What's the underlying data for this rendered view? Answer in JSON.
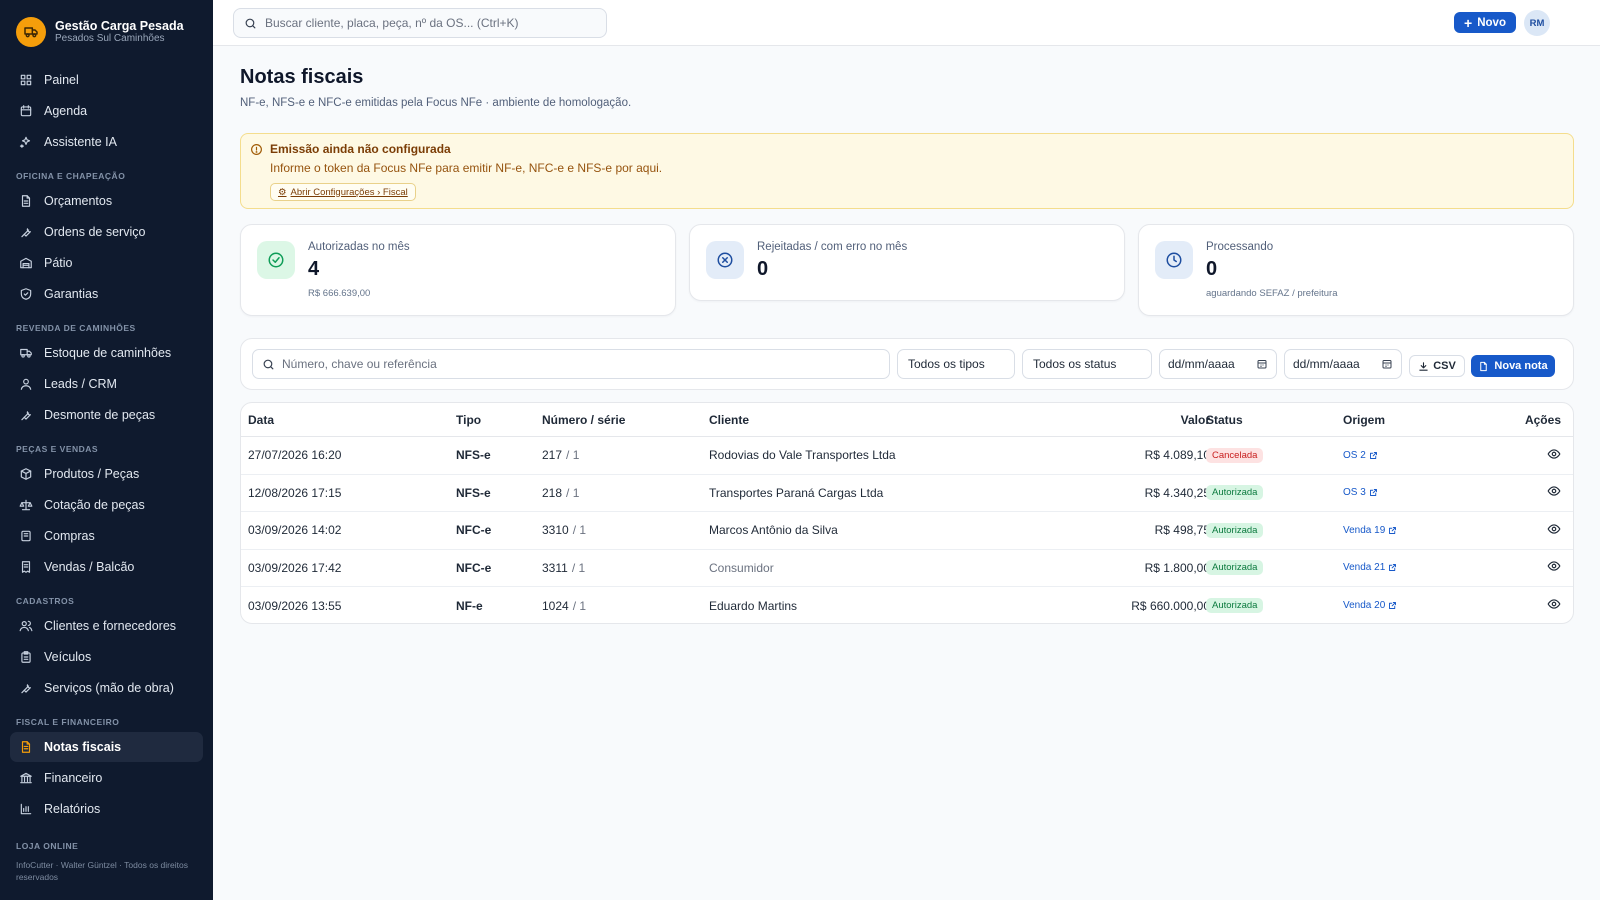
{
  "brand": {
    "title": "Gestão Carga Pesada",
    "subtitle": "Pesados Sul Caminhões"
  },
  "topbar": {
    "search_placeholder": "Buscar cliente, placa, peça, nº da OS...  (Ctrl+K)",
    "new_button": "Novo",
    "avatar_initials": "RM"
  },
  "sidebar": {
    "top_items": [
      {
        "label": "Painel",
        "icon": "dashboard-icon"
      },
      {
        "label": "Agenda",
        "icon": "calendar-icon"
      },
      {
        "label": "Assistente IA",
        "icon": "sparkles-icon"
      }
    ],
    "sections": [
      {
        "title": "OFICINA E CHAPEAÇÃO",
        "items": [
          {
            "label": "Orçamentos",
            "icon": "document-icon"
          },
          {
            "label": "Ordens de serviço",
            "icon": "wrench-icon"
          },
          {
            "label": "Pátio",
            "icon": "warehouse-icon"
          },
          {
            "label": "Garantias",
            "icon": "shield-icon"
          }
        ]
      },
      {
        "title": "REVENDA DE CAMINHÕES",
        "items": [
          {
            "label": "Estoque de caminhões",
            "icon": "truck-icon"
          },
          {
            "label": "Leads / CRM",
            "icon": "user-icon"
          },
          {
            "label": "Desmonte de peças",
            "icon": "wrench-icon"
          }
        ]
      },
      {
        "title": "PEÇAS E VENDAS",
        "items": [
          {
            "label": "Produtos / Peças",
            "icon": "box-icon"
          },
          {
            "label": "Cotação de peças",
            "icon": "scale-icon"
          },
          {
            "label": "Compras",
            "icon": "cart-icon"
          },
          {
            "label": "Vendas / Balcão",
            "icon": "receipt-icon"
          }
        ]
      },
      {
        "title": "CADASTROS",
        "items": [
          {
            "label": "Clientes e fornecedores",
            "icon": "users-icon"
          },
          {
            "label": "Veículos",
            "icon": "clipboard-icon"
          },
          {
            "label": "Serviços (mão de obra)",
            "icon": "wrench-icon"
          }
        ]
      },
      {
        "title": "FISCAL E FINANCEIRO",
        "items": [
          {
            "label": "Notas fiscais",
            "icon": "invoice-icon",
            "active": true
          },
          {
            "label": "Financeiro",
            "icon": "bank-icon"
          },
          {
            "label": "Relatórios",
            "icon": "bar-chart-icon"
          }
        ]
      }
    ],
    "footer_section": "LOJA ONLINE",
    "footer_text": "InfoCutter · Walter Güntzel · Todos os direitos reservados"
  },
  "page": {
    "title": "Notas fiscais",
    "subtitle": "NF-e, NFS-e e NFC-e emitidas pela Focus NFe · ambiente de homologação."
  },
  "alert": {
    "title": "Emissão ainda não configurada",
    "text": "Informe o token da Focus NFe para emitir NF-e, NFC-e e NFS-e por aqui.",
    "link": "Abrir Configurações › Fiscal"
  },
  "stats": [
    {
      "label": "Autorizadas no mês",
      "value": "4",
      "sub": "R$ 666.639,00",
      "icon": "check-circle-icon",
      "color": "#0f9d58",
      "bg": "#dcf7e6"
    },
    {
      "label": "Rejeitadas / com erro no mês",
      "value": "0",
      "sub": "",
      "icon": "x-circle-icon",
      "color": "#1e4ea0",
      "bg": "#e3ecf8"
    },
    {
      "label": "Processando",
      "value": "0",
      "sub": "aguardando SEFAZ / prefeitura",
      "icon": "clock-icon",
      "color": "#1e4ea0",
      "bg": "#e3ecf8"
    }
  ],
  "filters": {
    "search_placeholder": "Número, chave ou referência",
    "type_select": "Todos os tipos",
    "status_select": "Todos os status",
    "date_from": "dd/mm/aaaa",
    "date_to": "dd/mm/aaaa",
    "csv_label": "CSV",
    "new_invoice_label": "Nova nota"
  },
  "table": {
    "headers": {
      "data": "Data",
      "tipo": "Tipo",
      "numero": "Número / série",
      "cliente": "Cliente",
      "valor": "Valor",
      "status": "Status",
      "origem": "Origem",
      "acoes": "Ações"
    },
    "rows": [
      {
        "data": "27/07/2026 16:20",
        "tipo": "NFS-e",
        "numero": "217",
        "serie": "/ 1",
        "cliente": "Rodovias do Vale Transportes Ltda",
        "valor": "R$ 4.089,10",
        "status": "Cancelada",
        "origem": "OS 2"
      },
      {
        "data": "12/08/2026 17:15",
        "tipo": "NFS-e",
        "numero": "218",
        "serie": "/ 1",
        "cliente": "Transportes Paraná Cargas Ltda",
        "valor": "R$ 4.340,25",
        "status": "Autorizada",
        "origem": "OS 3"
      },
      {
        "data": "03/09/2026 14:02",
        "tipo": "NFC-e",
        "numero": "3310",
        "serie": "/ 1",
        "cliente": "Marcos Antônio da Silva",
        "valor": "R$ 498,75",
        "status": "Autorizada",
        "origem": "Venda 19"
      },
      {
        "data": "03/09/2026 17:42",
        "tipo": "NFC-e",
        "numero": "3311",
        "serie": "/ 1",
        "cliente": "Consumidor",
        "valor": "R$ 1.800,00",
        "status": "Autorizada",
        "origem": "Venda 21",
        "muted_client": true
      },
      {
        "data": "03/09/2026 13:55",
        "tipo": "NF-e",
        "numero": "1024",
        "serie": "/ 1",
        "cliente": "Eduardo Martins",
        "valor": "R$ 660.000,00",
        "status": "Autorizada",
        "origem": "Venda 20"
      }
    ]
  },
  "colors": {
    "accent": "#1759c9",
    "sidebar_bg": "#0f1a2e",
    "brand_orange": "#f59e0b",
    "status_cancelada_bg": "#fde2e2",
    "status_cancelada_fg": "#c81e1e",
    "status_autorizada_bg": "#d7f5e3",
    "status_autorizada_fg": "#0b7a3e"
  }
}
